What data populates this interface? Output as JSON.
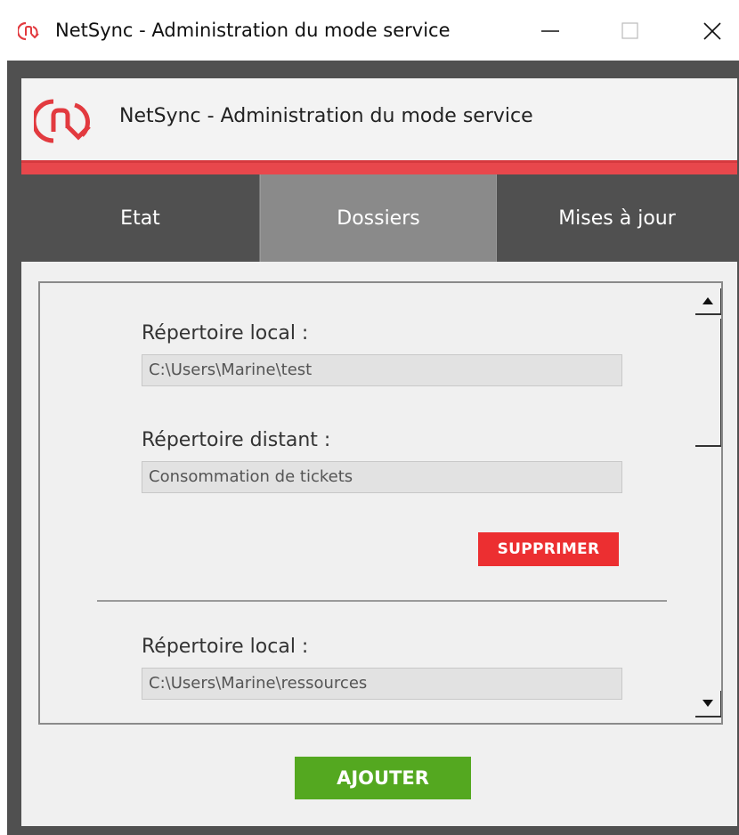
{
  "window": {
    "title": "NetSync - Administration du mode service"
  },
  "header": {
    "title": "NetSync - Administration du mode service",
    "accent_color": "#e8474c"
  },
  "tabs": [
    {
      "label": "Etat",
      "active": false
    },
    {
      "label": "Dossiers",
      "active": true
    },
    {
      "label": "Mises à jour",
      "active": false
    }
  ],
  "folders": [
    {
      "local_label": "Répertoire local :",
      "local_value": "C:\\Users\\Marine\\test",
      "remote_label": "Répertoire distant :",
      "remote_value": "Consommation de tickets",
      "delete_label": "SUPPRIMER"
    },
    {
      "local_label": "Répertoire local :",
      "local_value": "C:\\Users\\Marine\\ressources"
    }
  ],
  "actions": {
    "add_label": "AJOUTER",
    "add_color": "#54a820",
    "delete_color": "#ec2f31"
  }
}
